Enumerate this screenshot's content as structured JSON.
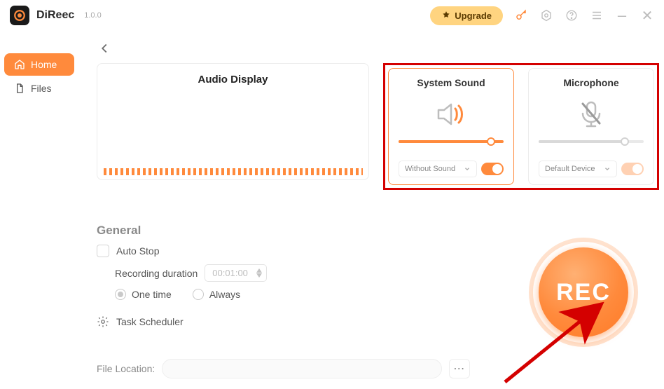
{
  "app": {
    "name": "DiReec",
    "version": "1.0.0"
  },
  "titlebar": {
    "upgrade": "Upgrade"
  },
  "sidebar": {
    "items": [
      {
        "icon": "home",
        "label": "Home",
        "active": true
      },
      {
        "icon": "files",
        "label": "Files",
        "active": false
      }
    ]
  },
  "cards": {
    "audio": {
      "title": "Audio Display"
    },
    "system_sound": {
      "title": "System Sound",
      "device": "Without Sound",
      "slider_pct": 88,
      "toggle_on": true
    },
    "microphone": {
      "title": "Microphone",
      "device": "Default Device",
      "slider_pct": 82,
      "toggle_on": false
    }
  },
  "general": {
    "title": "General",
    "auto_stop": "Auto Stop",
    "duration_label": "Recording duration",
    "duration_value": "00:01:00",
    "one_time": "One time",
    "always": "Always",
    "task_scheduler": "Task Scheduler",
    "file_location_label": "File Location:"
  },
  "rec": {
    "label": "REC"
  },
  "colors": {
    "accent": "#ff8a3c",
    "red": "#d40000"
  }
}
